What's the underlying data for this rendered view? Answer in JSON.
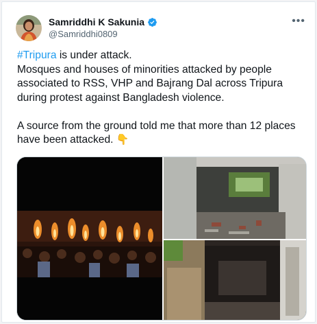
{
  "author": {
    "name": "Samriddhi K Sakunia",
    "handle": "@Samriddhi0809",
    "verified": true,
    "avatar_icon": "profile-photo"
  },
  "menu": {
    "icon": "more-options-icon",
    "glyph": "•••"
  },
  "tweet": {
    "hashtag": "#Tripura",
    "line1_rest": " is under attack.",
    "body": "\nMosques and houses of minorities attacked by people associated to RSS, VHP and Bajrang Dal across Tripura during protest against Bangladesh violence.\n\nA source from the ground told me that more than 12 places have been attacked. ",
    "emoji": "👇"
  },
  "media": {
    "images": [
      {
        "name": "torch-rally-photo"
      },
      {
        "name": "damaged-room-photo"
      },
      {
        "name": "burnt-interior-photo"
      }
    ]
  },
  "colors": {
    "link": "#1d9bf0",
    "verified": "#1d9bf0",
    "secondary": "#536471"
  }
}
